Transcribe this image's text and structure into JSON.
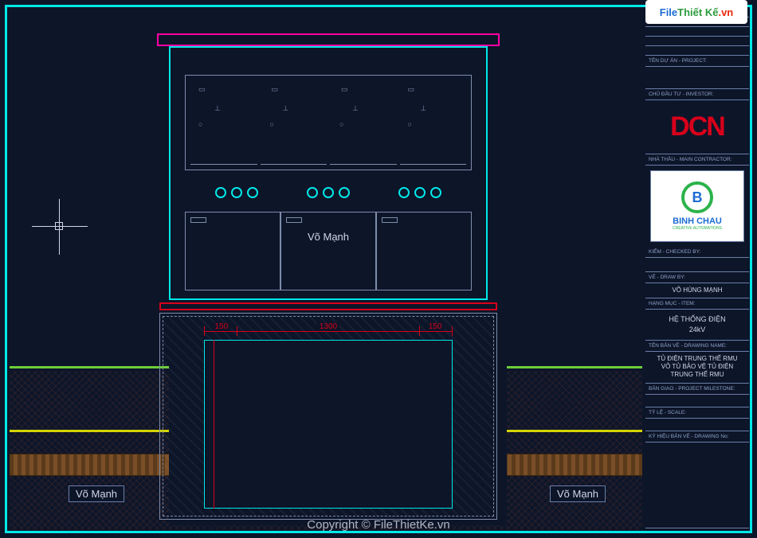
{
  "watermark": {
    "site_part1": "File",
    "site_part2": "Thiết Kế",
    "domain": ".vn"
  },
  "author_label": "Võ Mạnh",
  "titleblock": {
    "project_label": "TÊN DỰ ÁN - PROJECT:",
    "investor_label": "CHỦ ĐẦU TƯ - INVESTOR:",
    "logo_dcn": "DCN",
    "contractor_label": "NHÀ THẦU - MAIN CONTRACTOR:",
    "binhchau_name": "BINH CHAU",
    "binhchau_sub": "CREATIVE AUTOMATIONS",
    "checked_label": "KIỂM - CHECKED BY:",
    "drawn_label": "VẼ - DRAW BY:",
    "drawn_by": "VÕ HÙNG MẠNH",
    "item_label": "HẠNG MỤC - ITEM:",
    "item_line1": "HỆ THỐNG ĐIỆN",
    "item_line2": "24kV",
    "dwgname_label": "TÊN BẢN VẼ - DRAWING NAME:",
    "dwgname_l1": "TỦ ĐIỆN TRUNG THẾ RMU",
    "dwgname_l2": "VỎ TỦ BẢO VỆ TỦ ĐIỆN",
    "dwgname_l3": "TRUNG THẾ RMU",
    "milestone_label": "BẢN GIAO - PROJECT MILESTONE:",
    "scale_label": "TỶ LỆ - SCALE:",
    "dwgno_label": "KÝ HIỆU BẢN VẼ - DRAWING No:"
  },
  "dimensions": {
    "left_margin": "150",
    "pit_width": "1300",
    "right_margin": "150"
  },
  "copyright": "Copyright © FileThietKe.vn"
}
